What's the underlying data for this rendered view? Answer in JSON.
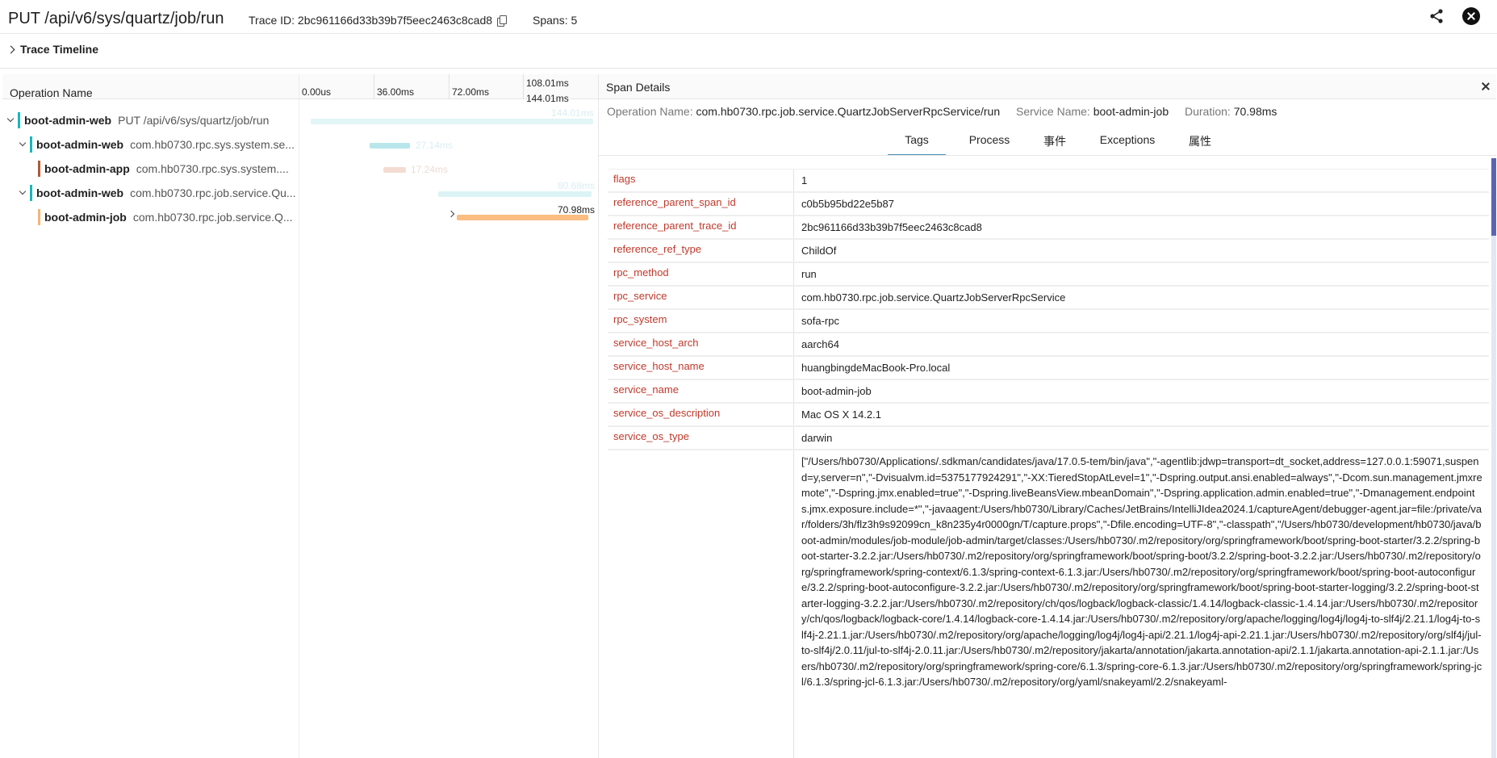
{
  "header": {
    "title": "PUT /api/v6/sys/quartz/job/run",
    "trace_id": "Trace ID: 2bc961166d33b39b7f5eec2463c8cad8",
    "spans": "Spans: 5"
  },
  "timeline": {
    "toggle_label": "Trace Timeline",
    "op_header": "Operation Name",
    "ticks": [
      "0.00us",
      "36.00ms",
      "72.00ms",
      "108.01ms",
      "144.01ms"
    ]
  },
  "rows": [
    {
      "service": "boot-admin-web",
      "operation": "PUT /api/v6/sys/quartz/job/run",
      "color": "#17b8be",
      "duration": "144.01ms",
      "bar_color": "#e2f5f7"
    },
    {
      "service": "boot-admin-web",
      "operation": "com.hb0730.rpc.sys.system.se...",
      "color": "#17b8be",
      "duration": "27.14ms",
      "bar_color": "#b8e6eb"
    },
    {
      "service": "boot-admin-app",
      "operation": "com.hb0730.rpc.sys.system....",
      "color": "#b05a36",
      "duration": "17.24ms",
      "bar_color": "#f4dcd3"
    },
    {
      "service": "boot-admin-web",
      "operation": "com.hb0730.rpc.job.service.Qu...",
      "color": "#17b8be",
      "duration": "80.68ms",
      "bar_color": "#dcf3f5"
    },
    {
      "service": "boot-admin-job",
      "operation": "com.hb0730.rpc.job.service.Q...",
      "color": "#f8b474",
      "duration": "70.98ms",
      "bar_color": "#fbbd82"
    }
  ],
  "detail": {
    "title": "Span Details",
    "operation_label": "Operation Name:",
    "operation_value": "com.hb0730.rpc.job.service.QuartzJobServerRpcService/run",
    "service_label": "Service Name:",
    "service_value": "boot-admin-job",
    "duration_label": "Duration:",
    "duration_value": "70.98ms",
    "tabs": [
      "Tags",
      "Process",
      "事件",
      "Exceptions",
      "属性"
    ],
    "tags": [
      {
        "key": "flags",
        "value": "1"
      },
      {
        "key": "reference_parent_span_id",
        "value": "c0b5b95bd22e5b87"
      },
      {
        "key": "reference_parent_trace_id",
        "value": "2bc961166d33b39b7f5eec2463c8cad8"
      },
      {
        "key": "reference_ref_type",
        "value": "ChildOf"
      },
      {
        "key": "rpc_method",
        "value": "run"
      },
      {
        "key": "rpc_service",
        "value": "com.hb0730.rpc.job.service.QuartzJobServerRpcService"
      },
      {
        "key": "rpc_system",
        "value": "sofa-rpc"
      },
      {
        "key": "service_host_arch",
        "value": "aarch64"
      },
      {
        "key": "service_host_name",
        "value": "huangbingdeMacBook-Pro.local"
      },
      {
        "key": "service_name",
        "value": "boot-admin-job"
      },
      {
        "key": "service_os_description",
        "value": "Mac OS X 14.2.1"
      },
      {
        "key": "service_os_type",
        "value": "darwin"
      },
      {
        "key": "",
        "value": "[\"/Users/hb0730/Applications/.sdkman/candidates/java/17.0.5-tem/bin/java\",\"-agentlib:jdwp=transport=dt_socket,address=127.0.0.1:59071,suspend=y,server=n\",\"-Dvisualvm.id=5375177924291\",\"-XX:TieredStopAtLevel=1\",\"-Dspring.output.ansi.enabled=always\",\"-Dcom.sun.management.jmxremote\",\"-Dspring.jmx.enabled=true\",\"-Dspring.liveBeansView.mbeanDomain\",\"-Dspring.application.admin.enabled=true\",\"-Dmanagement.endpoints.jmx.exposure.include=*\",\"-javaagent:/Users/hb0730/Library/Caches/JetBrains/IntelliJIdea2024.1/captureAgent/debugger-agent.jar=file:/private/var/folders/3h/flz3h9s92099cn_k8n235y4r0000gn/T/capture.props\",\"-Dfile.encoding=UTF-8\",\"-classpath\",\"/Users/hb0730/development/hb0730/java/boot-admin/modules/job-module/job-admin/target/classes:/Users/hb0730/.m2/repository/org/springframework/boot/spring-boot-starter/3.2.2/spring-boot-starter-3.2.2.jar:/Users/hb0730/.m2/repository/org/springframework/boot/spring-boot/3.2.2/spring-boot-3.2.2.jar:/Users/hb0730/.m2/repository/org/springframework/spring-context/6.1.3/spring-context-6.1.3.jar:/Users/hb0730/.m2/repository/org/springframework/boot/spring-boot-autoconfigure/3.2.2/spring-boot-autoconfigure-3.2.2.jar:/Users/hb0730/.m2/repository/org/springframework/boot/spring-boot-starter-logging/3.2.2/spring-boot-starter-logging-3.2.2.jar:/Users/hb0730/.m2/repository/ch/qos/logback/logback-classic/1.4.14/logback-classic-1.4.14.jar:/Users/hb0730/.m2/repository/ch/qos/logback/logback-core/1.4.14/logback-core-1.4.14.jar:/Users/hb0730/.m2/repository/org/apache/logging/log4j/log4j-to-slf4j/2.21.1/log4j-to-slf4j-2.21.1.jar:/Users/hb0730/.m2/repository/org/apache/logging/log4j/log4j-api/2.21.1/log4j-api-2.21.1.jar:/Users/hb0730/.m2/repository/org/slf4j/jul-to-slf4j/2.0.11/jul-to-slf4j-2.0.11.jar:/Users/hb0730/.m2/repository/jakarta/annotation/jakarta.annotation-api/2.1.1/jakarta.annotation-api-2.1.1.jar:/Users/hb0730/.m2/repository/org/springframework/spring-core/6.1.3/spring-core-6.1.3.jar:/Users/hb0730/.m2/repository/org/springframework/spring-jcl/6.1.3/spring-jcl-6.1.3.jar:/Users/hb0730/.m2/repository/org/yaml/snakeyaml/2.2/snakeyaml-"
      }
    ]
  }
}
